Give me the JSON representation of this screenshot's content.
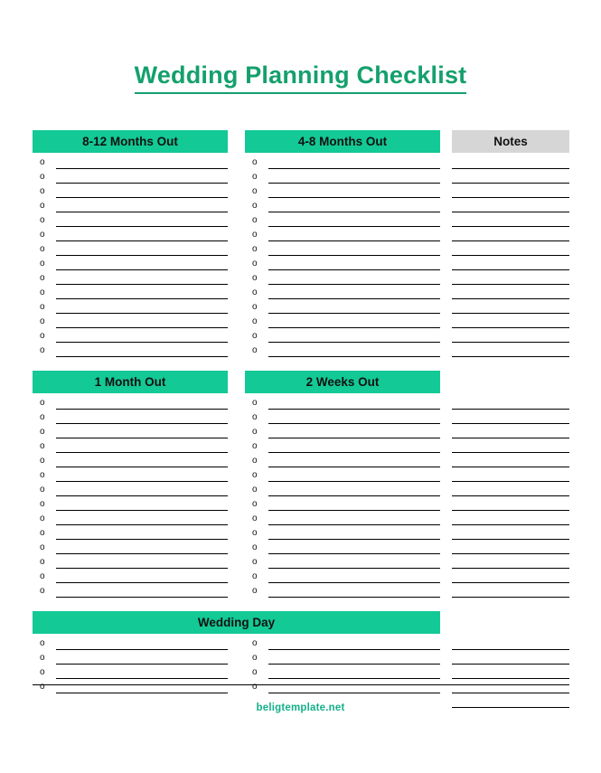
{
  "document": {
    "title": "Wedding Planning Checklist",
    "footer": "beligtemplate.net"
  },
  "colors": {
    "header_green": "#13c995",
    "header_gray": "#d6d6d6",
    "title_green": "#14a06d",
    "footer_green": "#13b08a",
    "rule_black": "#000000",
    "page_background": "#ffffff"
  },
  "icons": {
    "bullet": "o"
  },
  "sections": [
    {
      "id": "months_8_12",
      "label": "8-12 Months Out",
      "style": "green",
      "rows": 14,
      "bulleted": true
    },
    {
      "id": "months_4_8",
      "label": "4-8 Months Out",
      "style": "green",
      "rows": 14,
      "bulleted": true
    },
    {
      "id": "month_1",
      "label": "1 Month Out",
      "style": "green",
      "rows": 14,
      "bulleted": true
    },
    {
      "id": "weeks_2",
      "label": "2 Weeks Out",
      "style": "green",
      "rows": 14,
      "bulleted": true
    },
    {
      "id": "wedding_day",
      "label": "Wedding Day",
      "style": "green",
      "rows": 4,
      "bulleted": true,
      "spans_two_columns": true
    }
  ],
  "notes": {
    "label": "Notes",
    "style": "gray",
    "rows_band_1": 14,
    "rows_band_2": 14,
    "rows_band_3": 5,
    "bulleted": false
  }
}
